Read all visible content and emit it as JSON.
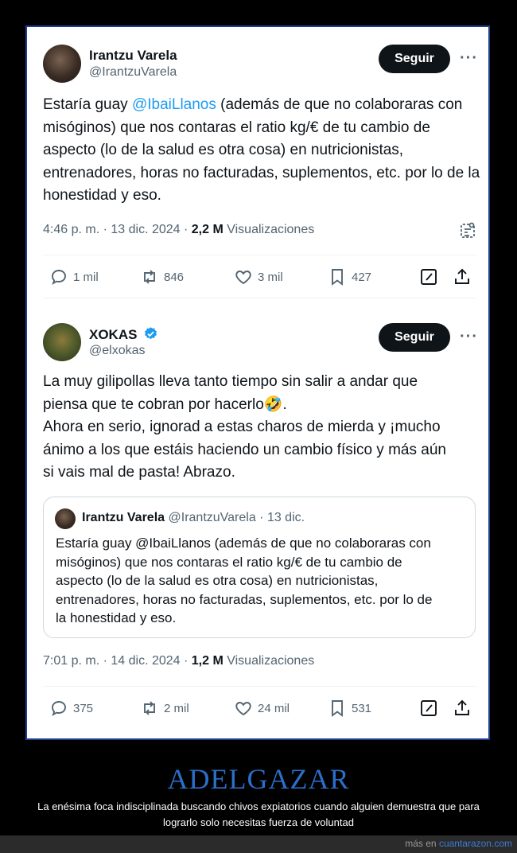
{
  "tweet1": {
    "name": "Irantzu Varela",
    "handle": "@IrantzuVarela",
    "follow_label": "Seguir",
    "more": "···",
    "text_pre": "Estaría guay ",
    "mention": "@IbaiLlanos",
    "text_post": " (además de que no colaboraras con misóginos) que nos contaras el ratio kg/€ de tu cambio de aspecto (lo de la salud es otra cosa) en nutricionistas, entrenadores, horas no facturadas, suplementos, etc. por lo de la honestidad y eso.",
    "time": "4:46 p. m. · 13 dic. 2024 · ",
    "views_count": "2,2 M",
    "views_label": " Visualizaciones",
    "stats": {
      "replies": "1 mil",
      "retweets": "846",
      "likes": "3 mil",
      "bookmarks": "427"
    }
  },
  "tweet2": {
    "name": "XOKAS",
    "handle": "@elxokas",
    "follow_label": "Seguir",
    "more": "···",
    "text": "La muy gilipollas lleva tanto tiempo sin salir a andar que\npiensa que te cobran por hacerlo🤣.\nAhora en serio, ignorad a estas charos de mierda y ¡mucho\nánimo a los que estáis haciendo un cambio físico y más aún\nsi vais mal de pasta! Abrazo.",
    "quote": {
      "name": "Irantzu Varela",
      "handle_date": "@IrantzuVarela · 13 dic.",
      "text": "Estaría guay @IbaiLlanos (además de que no colaboraras con\nmisóginos) que nos contaras el ratio kg/€ de tu cambio de\naspecto (lo de la salud es otra cosa) en nutricionistas,\nentrenadores, horas no facturadas, suplementos, etc. por lo de\nla honestidad y eso."
    },
    "time": "7:01 p. m. · 14 dic. 2024 · ",
    "views_count": "1,2 M",
    "views_label": " Visualizaciones",
    "stats": {
      "replies": "375",
      "retweets": "2 mil",
      "likes": "24 mil",
      "bookmarks": "531"
    }
  },
  "footer": {
    "title": "ADELGAZAR",
    "description": "La enésima foca indisciplinada buscando chivos expiatorios cuando alguien demuestra que para lograrlo solo necesitas fuerza de voluntad",
    "credit_prefix": "más en ",
    "credit_link": "cuantarazon.com"
  },
  "colors": {
    "accent": "#1d9bf0",
    "title_blue": "#2a6fc9",
    "verified": "#1d9bf0"
  }
}
